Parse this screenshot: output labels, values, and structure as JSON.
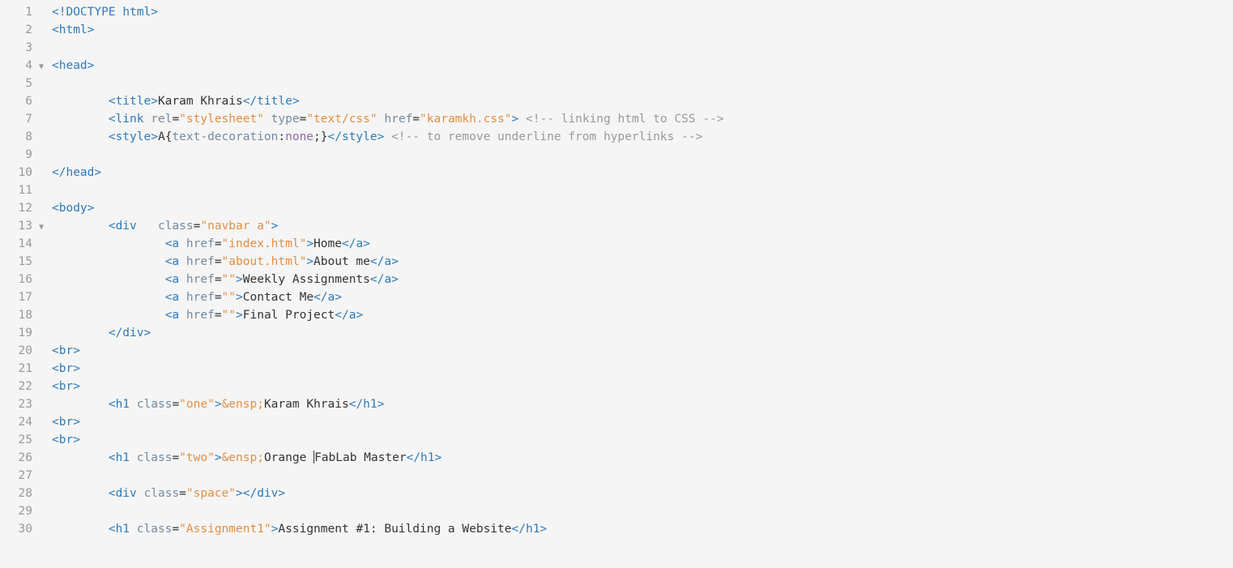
{
  "lineCount": 30,
  "foldMarkers": [
    4,
    13
  ],
  "lines": [
    {
      "tokens": [
        {
          "t": "<!DOCTYPE",
          "c": "c-tag"
        },
        {
          "t": " ",
          "c": ""
        },
        {
          "t": "html",
          "c": "c-tag"
        },
        {
          "t": ">",
          "c": "c-tag"
        }
      ]
    },
    {
      "tokens": [
        {
          "t": "<html>",
          "c": "c-tag"
        }
      ]
    },
    {
      "tokens": []
    },
    {
      "tokens": [
        {
          "t": "<head>",
          "c": "c-tag"
        }
      ]
    },
    {
      "tokens": []
    },
    {
      "indent": 2,
      "tokens": [
        {
          "t": "<title>",
          "c": "c-tag"
        },
        {
          "t": "Karam Khrais",
          "c": "c-text"
        },
        {
          "t": "</title>",
          "c": "c-tag"
        }
      ]
    },
    {
      "indent": 2,
      "tokens": [
        {
          "t": "<link",
          "c": "c-tag"
        },
        {
          "t": " ",
          "c": ""
        },
        {
          "t": "rel",
          "c": "c-attr"
        },
        {
          "t": "=",
          "c": ""
        },
        {
          "t": "\"stylesheet\"",
          "c": "c-str"
        },
        {
          "t": " ",
          "c": ""
        },
        {
          "t": "type",
          "c": "c-attr"
        },
        {
          "t": "=",
          "c": ""
        },
        {
          "t": "\"text/css\"",
          "c": "c-str"
        },
        {
          "t": " ",
          "c": ""
        },
        {
          "t": "href",
          "c": "c-attr"
        },
        {
          "t": "=",
          "c": ""
        },
        {
          "t": "\"karamkh.css\"",
          "c": "c-str"
        },
        {
          "t": ">",
          "c": "c-tag"
        },
        {
          "t": " ",
          "c": ""
        },
        {
          "t": "<!-- linking html to CSS -->",
          "c": "c-comment"
        }
      ]
    },
    {
      "indent": 2,
      "tokens": [
        {
          "t": "<style>",
          "c": "c-tag"
        },
        {
          "t": "A",
          "c": "c-text"
        },
        {
          "t": "{",
          "c": ""
        },
        {
          "t": "text-decoration",
          "c": "c-prop"
        },
        {
          "t": ":",
          "c": ""
        },
        {
          "t": "none",
          "c": "c-keyword"
        },
        {
          "t": ";",
          "c": ""
        },
        {
          "t": "}",
          "c": ""
        },
        {
          "t": "</style>",
          "c": "c-tag"
        },
        {
          "t": " ",
          "c": ""
        },
        {
          "t": "<!-- to remove underline from hyperlinks -->",
          "c": "c-comment"
        }
      ]
    },
    {
      "tokens": []
    },
    {
      "tokens": [
        {
          "t": "</head>",
          "c": "c-tag"
        }
      ]
    },
    {
      "tokens": []
    },
    {
      "tokens": [
        {
          "t": "<body>",
          "c": "c-tag"
        }
      ]
    },
    {
      "indent": 2,
      "tokens": [
        {
          "t": "<div",
          "c": "c-tag"
        },
        {
          "t": "   ",
          "c": ""
        },
        {
          "t": "class",
          "c": "c-attr"
        },
        {
          "t": "=",
          "c": ""
        },
        {
          "t": "\"navbar a\"",
          "c": "c-str"
        },
        {
          "t": ">",
          "c": "c-tag"
        }
      ]
    },
    {
      "indent": 4,
      "tokens": [
        {
          "t": "<a",
          "c": "c-tag"
        },
        {
          "t": " ",
          "c": ""
        },
        {
          "t": "href",
          "c": "c-attr"
        },
        {
          "t": "=",
          "c": ""
        },
        {
          "t": "\"index.html\"",
          "c": "c-str"
        },
        {
          "t": ">",
          "c": "c-tag"
        },
        {
          "t": "Home",
          "c": "c-text"
        },
        {
          "t": "</a>",
          "c": "c-tag"
        }
      ]
    },
    {
      "indent": 4,
      "tokens": [
        {
          "t": "<a",
          "c": "c-tag"
        },
        {
          "t": " ",
          "c": ""
        },
        {
          "t": "href",
          "c": "c-attr"
        },
        {
          "t": "=",
          "c": ""
        },
        {
          "t": "\"about.html\"",
          "c": "c-str"
        },
        {
          "t": ">",
          "c": "c-tag"
        },
        {
          "t": "About me",
          "c": "c-text"
        },
        {
          "t": "</a>",
          "c": "c-tag"
        }
      ]
    },
    {
      "indent": 4,
      "tokens": [
        {
          "t": "<a",
          "c": "c-tag"
        },
        {
          "t": " ",
          "c": ""
        },
        {
          "t": "href",
          "c": "c-attr"
        },
        {
          "t": "=",
          "c": ""
        },
        {
          "t": "\"\"",
          "c": "c-str"
        },
        {
          "t": ">",
          "c": "c-tag"
        },
        {
          "t": "Weekly Assignments",
          "c": "c-text"
        },
        {
          "t": "</a>",
          "c": "c-tag"
        }
      ]
    },
    {
      "indent": 4,
      "tokens": [
        {
          "t": "<a",
          "c": "c-tag"
        },
        {
          "t": " ",
          "c": ""
        },
        {
          "t": "href",
          "c": "c-attr"
        },
        {
          "t": "=",
          "c": ""
        },
        {
          "t": "\"\"",
          "c": "c-str"
        },
        {
          "t": ">",
          "c": "c-tag"
        },
        {
          "t": "Contact Me",
          "c": "c-text"
        },
        {
          "t": "</a>",
          "c": "c-tag"
        }
      ]
    },
    {
      "indent": 4,
      "tokens": [
        {
          "t": "<a",
          "c": "c-tag"
        },
        {
          "t": " ",
          "c": ""
        },
        {
          "t": "href",
          "c": "c-attr"
        },
        {
          "t": "=",
          "c": ""
        },
        {
          "t": "\"\"",
          "c": "c-str"
        },
        {
          "t": ">",
          "c": "c-tag"
        },
        {
          "t": "Final Project",
          "c": "c-text"
        },
        {
          "t": "</a>",
          "c": "c-tag"
        }
      ]
    },
    {
      "indent": 2,
      "tokens": [
        {
          "t": "</div>",
          "c": "c-tag"
        }
      ]
    },
    {
      "tokens": [
        {
          "t": "<br>",
          "c": "c-tag"
        }
      ]
    },
    {
      "tokens": [
        {
          "t": "<br>",
          "c": "c-tag"
        }
      ]
    },
    {
      "tokens": [
        {
          "t": "<br>",
          "c": "c-tag"
        }
      ]
    },
    {
      "indent": 2,
      "tokens": [
        {
          "t": "<h1",
          "c": "c-tag"
        },
        {
          "t": " ",
          "c": ""
        },
        {
          "t": "class",
          "c": "c-attr"
        },
        {
          "t": "=",
          "c": ""
        },
        {
          "t": "\"one\"",
          "c": "c-str"
        },
        {
          "t": ">",
          "c": "c-tag"
        },
        {
          "t": "&ensp;",
          "c": "c-entity"
        },
        {
          "t": "Karam Khrais",
          "c": "c-text"
        },
        {
          "t": "</h1>",
          "c": "c-tag"
        }
      ]
    },
    {
      "tokens": [
        {
          "t": "<br>",
          "c": "c-tag"
        }
      ]
    },
    {
      "tokens": [
        {
          "t": "<br>",
          "c": "c-tag"
        }
      ]
    },
    {
      "indent": 2,
      "tokens": [
        {
          "t": "<h1",
          "c": "c-tag"
        },
        {
          "t": " ",
          "c": ""
        },
        {
          "t": "class",
          "c": "c-attr"
        },
        {
          "t": "=",
          "c": ""
        },
        {
          "t": "\"two\"",
          "c": "c-str"
        },
        {
          "t": ">",
          "c": "c-tag"
        },
        {
          "t": "&ensp;",
          "c": "c-entity"
        },
        {
          "t": "Orange ",
          "c": "c-text"
        },
        {
          "cursor": true
        },
        {
          "t": "FabLab Master",
          "c": "c-text"
        },
        {
          "t": "</h1>",
          "c": "c-tag"
        }
      ]
    },
    {
      "tokens": []
    },
    {
      "indent": 2,
      "tokens": [
        {
          "t": "<div",
          "c": "c-tag"
        },
        {
          "t": " ",
          "c": ""
        },
        {
          "t": "class",
          "c": "c-attr"
        },
        {
          "t": "=",
          "c": ""
        },
        {
          "t": "\"space\"",
          "c": "c-str"
        },
        {
          "t": ">",
          "c": "c-tag"
        },
        {
          "t": "</div>",
          "c": "c-tag"
        }
      ]
    },
    {
      "tokens": []
    },
    {
      "indent": 2,
      "tokens": [
        {
          "t": "<h1",
          "c": "c-tag"
        },
        {
          "t": " ",
          "c": ""
        },
        {
          "t": "class",
          "c": "c-attr"
        },
        {
          "t": "=",
          "c": ""
        },
        {
          "t": "\"Assignment1\"",
          "c": "c-str"
        },
        {
          "t": ">",
          "c": "c-tag"
        },
        {
          "t": "Assignment #1: Building a Website",
          "c": "c-text"
        },
        {
          "t": "</h1>",
          "c": "c-tag"
        }
      ]
    }
  ]
}
